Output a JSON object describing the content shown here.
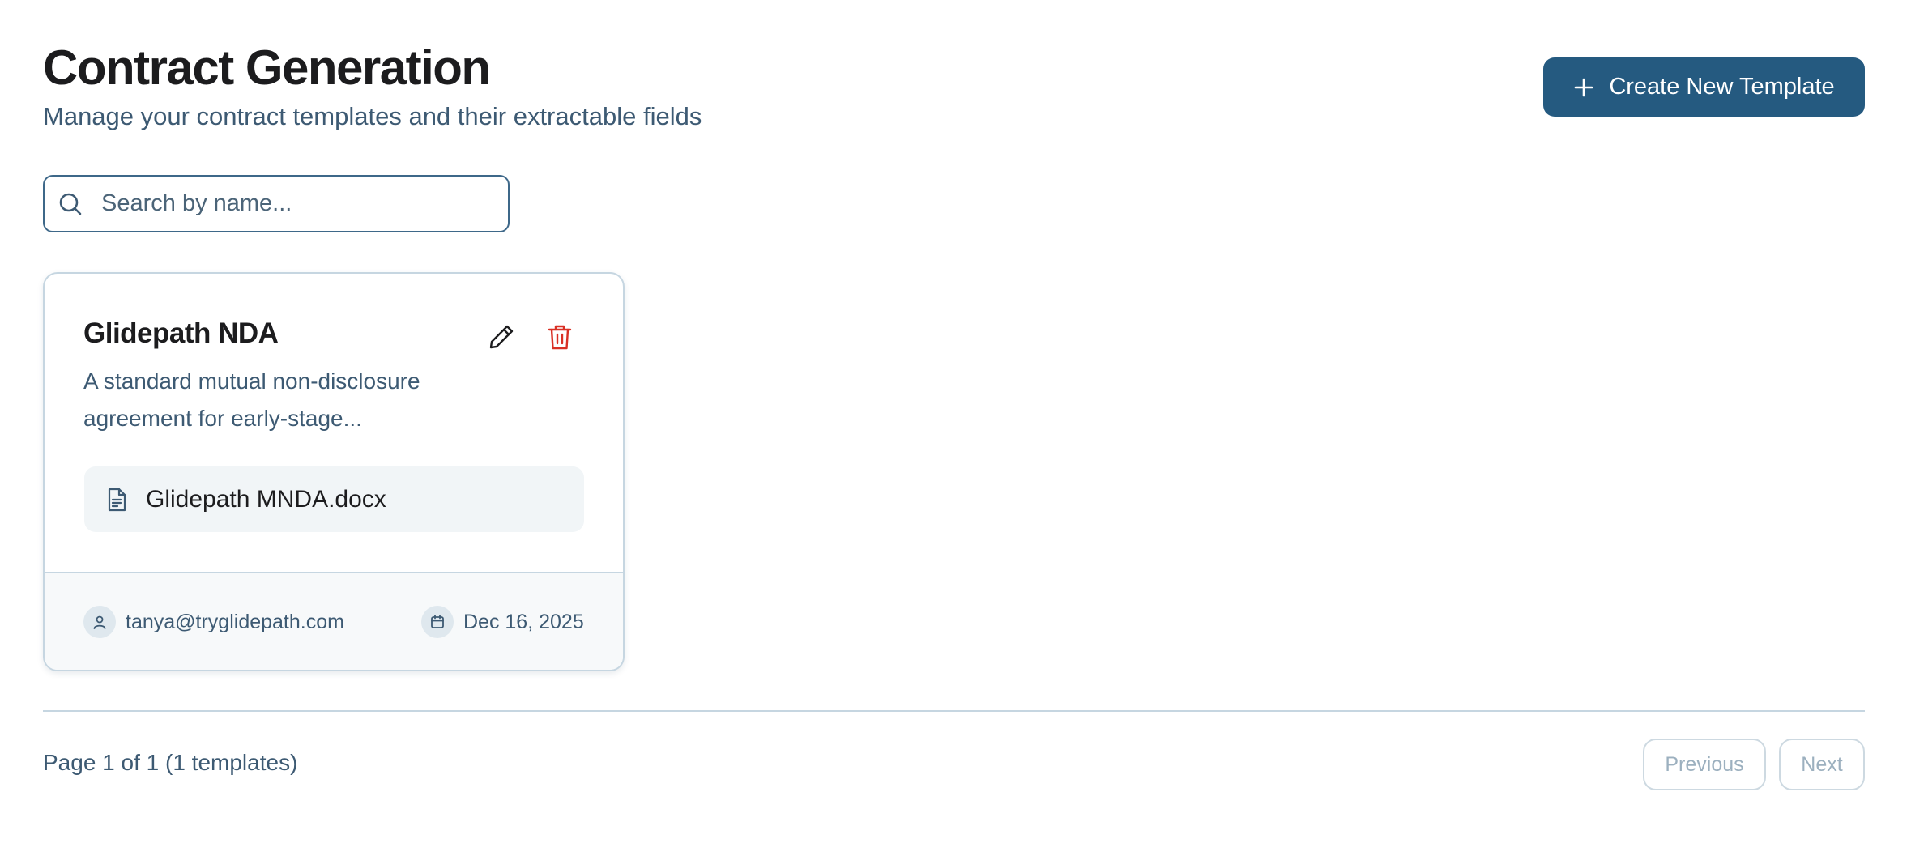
{
  "header": {
    "title": "Contract Generation",
    "subtitle": "Manage your contract templates and their extractable fields",
    "create_button_label": "Create New Template"
  },
  "search": {
    "placeholder": "Search by name...",
    "value": ""
  },
  "templates": [
    {
      "name": "Glidepath NDA",
      "description": "A standard mutual non-disclosure agreement for early-stage...",
      "file_name": "Glidepath MNDA.docx",
      "author": "tanya@tryglidepath.com",
      "date": "Dec 16, 2025"
    }
  ],
  "pagination": {
    "info": "Page 1 of 1 (1 templates)",
    "previous_label": "Previous",
    "next_label": "Next"
  },
  "icons": {
    "create": "plus-icon",
    "search": "search-icon",
    "edit": "pencil-icon",
    "delete": "trash-icon",
    "file": "file-text-icon",
    "author": "user-icon",
    "date": "calendar-icon"
  },
  "colors": {
    "primary": "#255a80",
    "danger": "#d93025",
    "muted_text": "#3d5a73",
    "border": "#c6d6e1"
  }
}
